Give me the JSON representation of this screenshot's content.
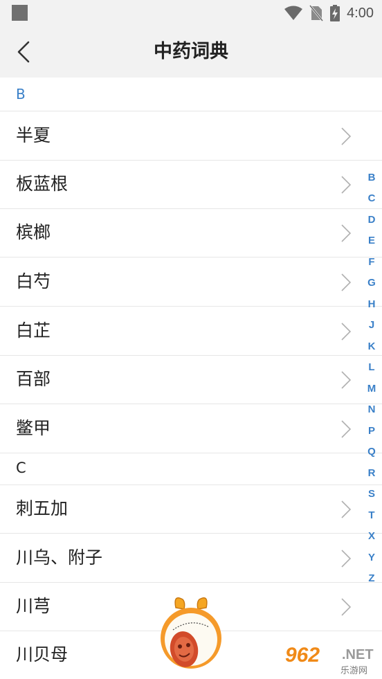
{
  "status_bar": {
    "time": "4:00",
    "icons": [
      "wifi-icon",
      "no-sim-icon",
      "battery-charging-icon"
    ]
  },
  "header": {
    "title": "中药词典",
    "back_icon": "back-chevron-icon"
  },
  "list": {
    "sections": [
      {
        "header": "B",
        "items": [
          "半夏",
          "板蓝根",
          "槟榔",
          "白芍",
          "白芷",
          "百部",
          "鳖甲"
        ]
      },
      {
        "header": "C",
        "items": [
          "刺五加",
          "川乌、附子",
          "川芎",
          "川贝母"
        ]
      }
    ]
  },
  "index_bar": {
    "letters": [
      "B",
      "C",
      "D",
      "E",
      "F",
      "G",
      "H",
      "J",
      "K",
      "L",
      "M",
      "N",
      "P",
      "Q",
      "R",
      "S",
      "T",
      "X",
      "Y",
      "Z"
    ]
  },
  "watermark": {
    "number": "962",
    "suffix": ".NET",
    "site_name": "乐游网"
  },
  "colors": {
    "accent": "#3a80c8",
    "header_bg": "#f2f2f2",
    "divider": "#e6e6e6"
  }
}
